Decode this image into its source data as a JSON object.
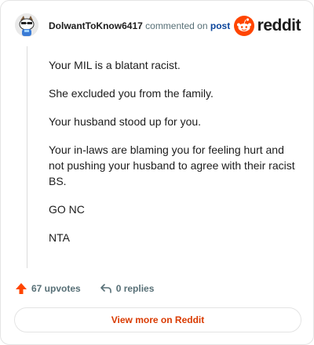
{
  "header": {
    "username": "DolwantToKnow6417",
    "commented_on": "commented on",
    "post_link": "post",
    "brand": "reddit"
  },
  "comment": {
    "paragraphs": [
      "Your MIL is a blatant racist.",
      "She excluded you from the family.",
      "Your husband stood up for you.",
      "Your in-laws are blaming you for feeling hurt and not pushing your husband to agree with their racist BS.",
      "GO NC",
      "NTA"
    ]
  },
  "actions": {
    "upvotes_label": "67 upvotes",
    "replies_label": "0 replies"
  },
  "footer": {
    "view_more_label": "View more on Reddit"
  },
  "colors": {
    "brand_orange": "#ff4500",
    "link_blue": "#0a449b",
    "view_more_text": "#d93a00",
    "muted_text": "#576f76"
  },
  "icons": {
    "avatar": "snoo-avatar",
    "brand": "reddit-logo-icon",
    "upvote": "upvote-arrow-icon",
    "reply": "reply-arrow-icon"
  }
}
